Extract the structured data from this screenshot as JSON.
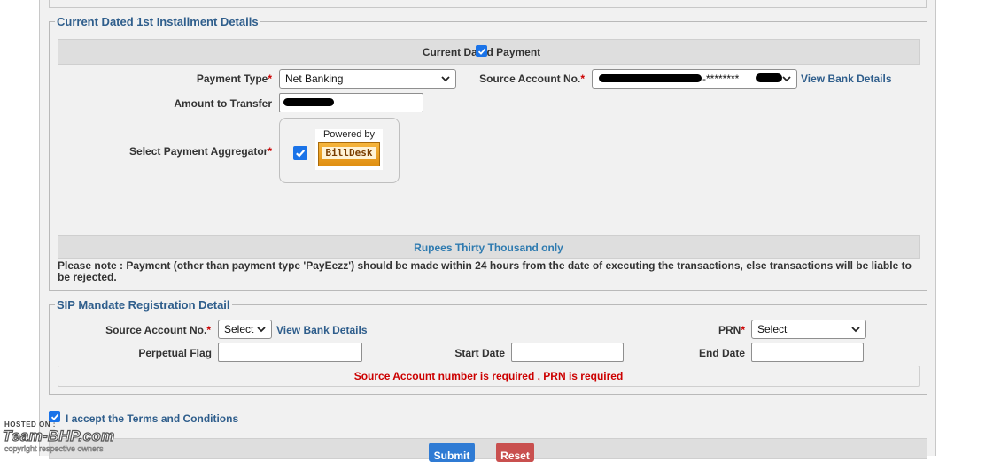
{
  "installment": {
    "legend": "Current Dated 1st Installment Details",
    "current_dated_label": "Current Dated Payment",
    "payment_type_label": "Payment Type",
    "payment_type_value": "Net Banking",
    "source_account_label": "Source Account No.",
    "source_account_masked": "-********",
    "view_bank_details": "View Bank Details",
    "amount_label": "Amount to Transfer",
    "aggregator_label": "Select Payment Aggregator",
    "billdesk_powered": "Powered by",
    "billdesk_name": "BillDesk",
    "amount_words": "Rupees Thirty Thousand only",
    "note": "Please note : Payment (other than payment type 'PayEezz') should be made within 24 hours from the date of executing the transactions, else transactions will be liable to be rejected."
  },
  "sip": {
    "legend": "SIP Mandate Registration Detail",
    "source_account_label": "Source Account No.",
    "source_account_value": "Select",
    "view_bank_details": "View Bank Details",
    "prn_label": "PRN",
    "prn_value": "Select",
    "perpetual_flag_label": "Perpetual Flag",
    "start_date_label": "Start Date",
    "end_date_label": "End Date",
    "error_message": "Source Account number is required , PRN is required"
  },
  "terms": {
    "label": "I accept the Terms and Conditions"
  },
  "actions": {
    "submit_label": "Submit",
    "reset_label": "Reset"
  },
  "watermark": {
    "hosted_on": "HOSTED ON :",
    "brand": "Team-BHP.com",
    "copyright": "copyright respective owners"
  },
  "colors": {
    "accent_blue": "#2f5e8c",
    "error_red": "#cc0000",
    "checkbox_blue": "#1a73e8",
    "submit_blue": "#2f7bd4",
    "reset_red": "#c9504f"
  }
}
